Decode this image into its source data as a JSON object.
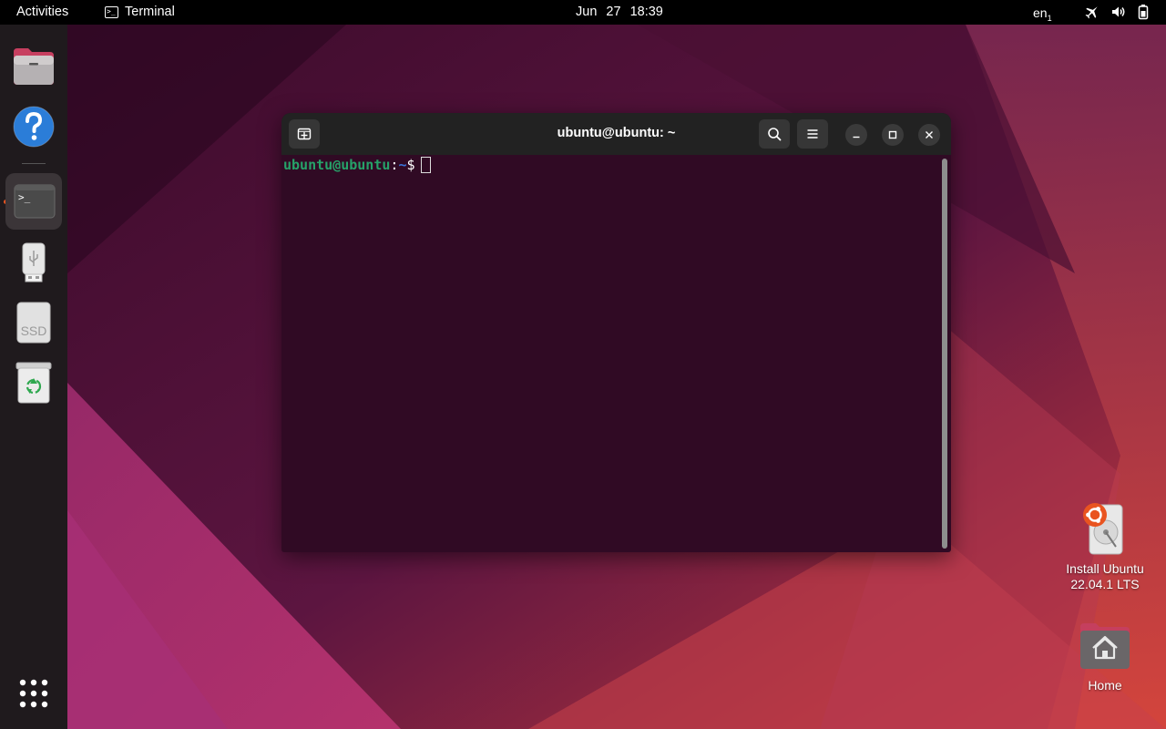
{
  "topbar": {
    "activities": "Activities",
    "app_name": "Terminal",
    "terminal_glyph": ">_",
    "date": "Jun 27",
    "time": "18:39",
    "language": "en",
    "language_sub": "1"
  },
  "dock": {
    "items": [
      {
        "name": "Files"
      },
      {
        "name": "Help"
      },
      {
        "name": "Terminal"
      },
      {
        "name": "USB Drive"
      },
      {
        "name": "SSD"
      },
      {
        "name": "Trash"
      }
    ],
    "terminal_glyph": ">_",
    "ssd_label": "SSD"
  },
  "terminal": {
    "title": "ubuntu@ubuntu: ~",
    "prompt_user": "ubuntu@ubuntu",
    "prompt_colon": ":",
    "prompt_path": "~",
    "prompt_dollar": "$"
  },
  "desktop": {
    "install_label_line1": "Install Ubuntu",
    "install_label_line2": "22.04.1 LTS",
    "home_label": "Home"
  },
  "colors": {
    "accent": "#e95420",
    "terminal_bg": "#300a24",
    "prompt_user": "#26a269",
    "prompt_path": "#3a73d8"
  }
}
